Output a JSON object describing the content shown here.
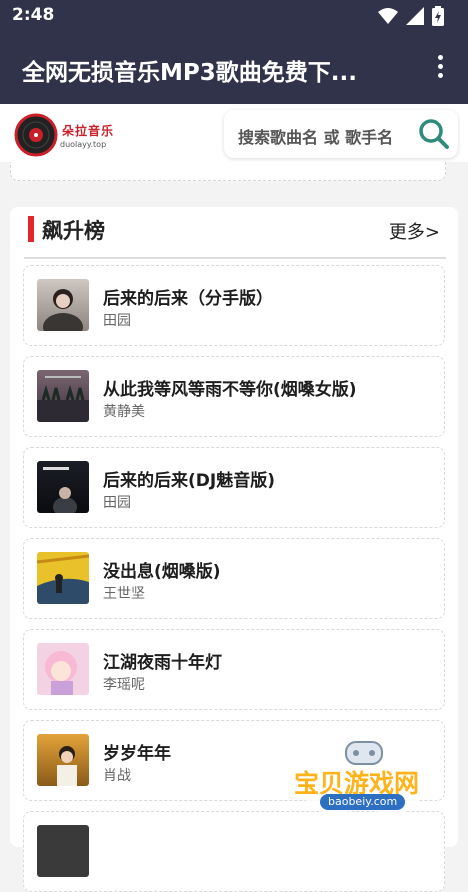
{
  "status_bar": {
    "time": "2:48",
    "icons": [
      "wifi-icon",
      "signal-icon",
      "battery-charging-icon"
    ]
  },
  "app_bar": {
    "title": "全网无损音乐MP3歌曲免费下...",
    "menu_icon": "more-vert-icon"
  },
  "header": {
    "logo_text": "朵拉音乐",
    "logo_sub": "duolayy.top",
    "search_placeholder": "搜索歌曲名 或 歌手名",
    "search_icon": "search-icon"
  },
  "section": {
    "title": "飙升榜",
    "more_label": "更多>"
  },
  "songs": [
    {
      "title": "后来的后来（分手版）",
      "artist": "田园"
    },
    {
      "title": "从此我等风等雨不等你(烟嗓女版)",
      "artist": "黄静美"
    },
    {
      "title": "后来的后来(DJ魅音版)",
      "artist": "田园"
    },
    {
      "title": "没出息(烟嗓版)",
      "artist": "王世坚"
    },
    {
      "title": "江湖夜雨十年灯",
      "artist": "李瑶呢"
    },
    {
      "title": "岁岁年年",
      "artist": "肖战"
    },
    {
      "title": "",
      "artist": ""
    }
  ],
  "watermark": {
    "text": "宝贝游戏网",
    "url": "baobeiy.com"
  },
  "colors": {
    "app_bar": "#30334a",
    "accent_red": "#e3262c",
    "search_icon": "#2e8b7a"
  }
}
